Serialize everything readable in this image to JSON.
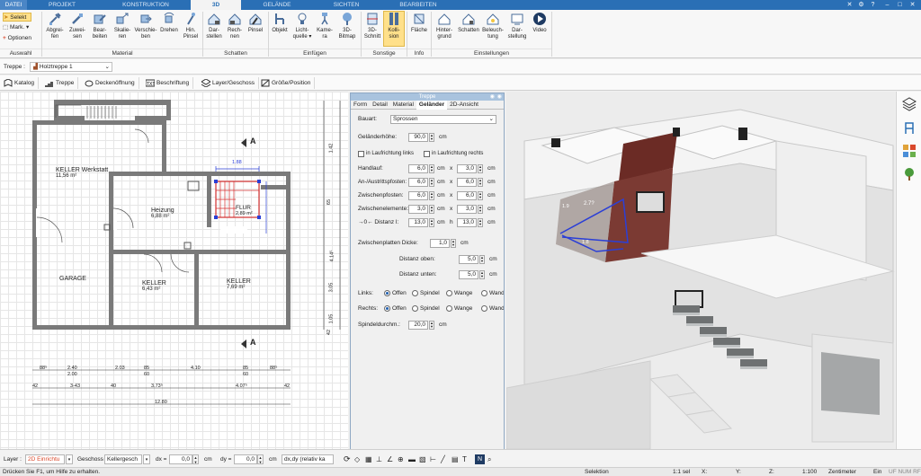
{
  "tabs": [
    {
      "label": "DATEI"
    },
    {
      "label": "PROJEKT"
    },
    {
      "label": "KONSTRUKTION"
    },
    {
      "label": "3D"
    },
    {
      "label": "GELÄNDE"
    },
    {
      "label": "SICHTEN"
    },
    {
      "label": "BEARBEITEN"
    }
  ],
  "ribbon": {
    "auswahl": {
      "selekt": "Selekt",
      "mark": "Mark.",
      "optionen": "Optionen",
      "label": "Auswahl"
    },
    "material": {
      "label": "Material",
      "buttons": [
        {
          "l1": "Abgrei-",
          "l2": "fen"
        },
        {
          "l1": "Zuwei-",
          "l2": "sen"
        },
        {
          "l1": "Bear-",
          "l2": "beiten"
        },
        {
          "l1": "Skalie-",
          "l2": "ren"
        },
        {
          "l1": "Verschie-",
          "l2": "ben"
        },
        {
          "l1": "Drehen",
          "l2": ""
        },
        {
          "l1": "Hin.",
          "l2": "Pinsel"
        }
      ]
    },
    "schatten": {
      "label": "Schatten",
      "buttons": [
        {
          "l1": "Dar-",
          "l2": "stellen"
        },
        {
          "l1": "Rech-",
          "l2": "nen"
        },
        {
          "l1": "Pinsel",
          "l2": ""
        }
      ]
    },
    "einfuegen": {
      "label": "Einfügen",
      "buttons": [
        {
          "l1": "Objekt",
          "l2": ""
        },
        {
          "l1": "Licht-",
          "l2": "quelle ▾"
        },
        {
          "l1": "Kame-",
          "l2": "ra"
        },
        {
          "l1": "3D-",
          "l2": "Bitmap"
        }
      ]
    },
    "sonstige": {
      "label": "Sonstige",
      "buttons": [
        {
          "l1": "3D-",
          "l2": "Schnitt"
        },
        {
          "l1": "Kolli-",
          "l2": "sion"
        }
      ]
    },
    "info": {
      "label": "Info",
      "buttons": [
        {
          "l1": "Fläche",
          "l2": ""
        }
      ]
    },
    "einstellungen": {
      "label": "Einstellungen",
      "buttons": [
        {
          "l1": "Hinter-",
          "l2": "grund"
        },
        {
          "l1": "Schatten",
          "l2": ""
        },
        {
          "l1": "Beleuch-",
          "l2": "tung"
        },
        {
          "l1": "Dar-",
          "l2": "stellung"
        },
        {
          "l1": "Video",
          "l2": ""
        }
      ]
    }
  },
  "row1": {
    "label": "Treppe :",
    "selected": "Holztreppe 1"
  },
  "row2": [
    "Katalog",
    "Treppe",
    "Deckenöffnung",
    "Beschriftung",
    "Layer/Geschoss",
    "Größe/Position"
  ],
  "plan": {
    "rooms": [
      {
        "name": "KELLER Werkstatt",
        "area": "11,56 m²"
      },
      {
        "name": "Heizung",
        "area": "6,88 m²"
      },
      {
        "name": "FLUR",
        "area": "2,89 m²"
      },
      {
        "name": "GARAGE",
        "area": ""
      },
      {
        "name": "KELLER",
        "area": "6,43 m²"
      },
      {
        "name": "KELLER",
        "area": "7,69 m²"
      }
    ],
    "dims_top": [
      "1.88"
    ],
    "dims_bottom1": [
      "88⁵",
      "2.40",
      "2.03",
      "85",
      "4.10",
      "85",
      "88⁵"
    ],
    "dims_bottom1b": [
      "2.00",
      "60",
      "60"
    ],
    "dims_bottom2": [
      "42",
      "3-43",
      "40",
      "3.73⁵",
      "4.07⁵",
      "42"
    ],
    "dims_total": "12.80",
    "dims_right": [
      "1.42",
      "65",
      "4.14⁵",
      "3.05",
      "1.05",
      "42"
    ],
    "section": "A"
  },
  "dialog": {
    "title": "Treppe",
    "tabs": [
      "Form",
      "Detail",
      "Material",
      "Geländer",
      "2D-Ansicht"
    ],
    "bauart_label": "Bauart:",
    "bauart_value": "Sprossen",
    "gelaenderhoehe_label": "Geländerhöhe:",
    "gelaenderhoehe_value": "90,0",
    "unit": "cm",
    "chk_links": "in Laufrichtung links",
    "chk_rechts": "in Laufrichtung rechts",
    "rows": [
      {
        "label": "Handlauf:",
        "a": "6,0",
        "b": "3,0",
        "sep": "x"
      },
      {
        "label": "An-/Austrittspfosten:",
        "a": "6,0",
        "b": "6,0",
        "sep": "x"
      },
      {
        "label": "Zwischenpfosten:",
        "a": "6,0",
        "b": "6,0",
        "sep": "x"
      },
      {
        "label": "Zwischenelemente:",
        "a": "3,0",
        "b": "3,0",
        "sep": "x"
      },
      {
        "label": "→0← Distanz l:",
        "a": "13,0",
        "b": "13,0",
        "sep": "h"
      }
    ],
    "zwischenplatten_label": "Zwischenplatten Dicke:",
    "zwischenplatten_value": "1,0",
    "distanz_oben_label": "Distanz oben:",
    "distanz_oben_value": "5,0",
    "distanz_unten_label": "Distanz unten:",
    "distanz_unten_value": "5,0",
    "links_label": "Links:",
    "rechts_label": "Rechts:",
    "options": [
      "Offen",
      "Spindel",
      "Wange",
      "Wand"
    ],
    "spindel_label": "Spindeldurchm.:",
    "spindel_value": "20,0"
  },
  "view3d": {
    "dim1": "2.7?",
    "dim2": "1.9",
    "dim3": "1.8"
  },
  "bottom": {
    "layer_label": "Layer :",
    "layer_value": "2D Einrichtu",
    "geschoss_label": "Geschoss :",
    "geschoss_value": "Kellergesch",
    "dx_label": "dx =",
    "dx_value": "0,0",
    "dy_label": "dy =",
    "dy_value": "0,0",
    "unit": "cm",
    "mode": "dx,dy (relativ ka"
  },
  "status": {
    "hint": "Drücken Sie F1, um Hilfe zu erhalten.",
    "mode": "Selektion",
    "sel": "1:1 sel",
    "x": "X:",
    "y": "Y:",
    "z": "Z:",
    "scale": "1:100",
    "unit": "Zentimeter",
    "ein": "Ein",
    "flags": "UF NUM RF"
  },
  "colors": {
    "accent": "#2a6fb5",
    "selection": "#d32f2f",
    "dimension": "#2b3fd6"
  }
}
